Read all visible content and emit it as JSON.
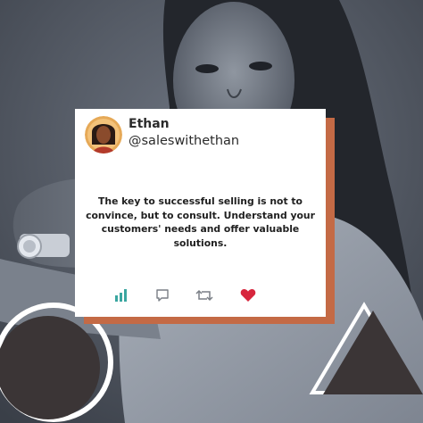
{
  "post": {
    "display_name": "Ethan",
    "handle": "@saleswithethan",
    "quote": "The key to successful selling is not to convince, but to consult. Understand your customers' needs and offer valuable solutions."
  },
  "actions": [
    {
      "icon": "stats-icon",
      "color": "#3aa6a0"
    },
    {
      "icon": "comment-icon",
      "color": "#7a7f86"
    },
    {
      "icon": "retweet-icon",
      "color": "#7a7f86"
    },
    {
      "icon": "heart-icon",
      "color": "#d7263d"
    }
  ],
  "colors": {
    "card_shadow": "#c46a45",
    "circle": "#3b3536",
    "triangle": "#3b3536",
    "background": "#4a505a"
  }
}
